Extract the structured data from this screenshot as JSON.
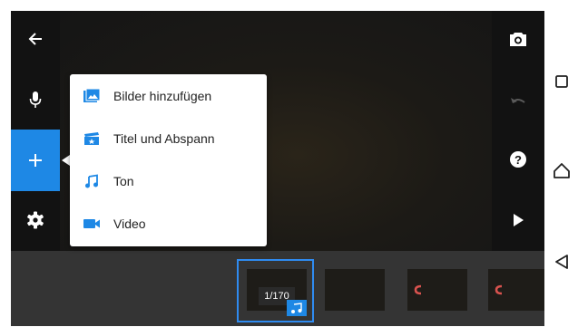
{
  "menu": {
    "items": [
      {
        "label": "Bilder hinzufügen",
        "icon": "add-images-icon"
      },
      {
        "label": "Titel und Abspann",
        "icon": "title-card-icon"
      },
      {
        "label": "Ton",
        "icon": "music-note-icon"
      },
      {
        "label": "Video",
        "icon": "video-camera-icon"
      }
    ]
  },
  "timeline": {
    "counter": "1/170"
  },
  "colors": {
    "accent": "#1e88e5",
    "menu_icon": "#1e88e5",
    "clip_marker": "#d9534f"
  },
  "toolbar_left": [
    "back-arrow-icon",
    "microphone-icon",
    "plus-icon",
    "gear-icon"
  ],
  "toolbar_right": [
    "camera-icon",
    "undo-icon",
    "help-icon",
    "play-icon"
  ],
  "system_nav": [
    "recent-apps-icon",
    "home-icon",
    "back-icon"
  ]
}
